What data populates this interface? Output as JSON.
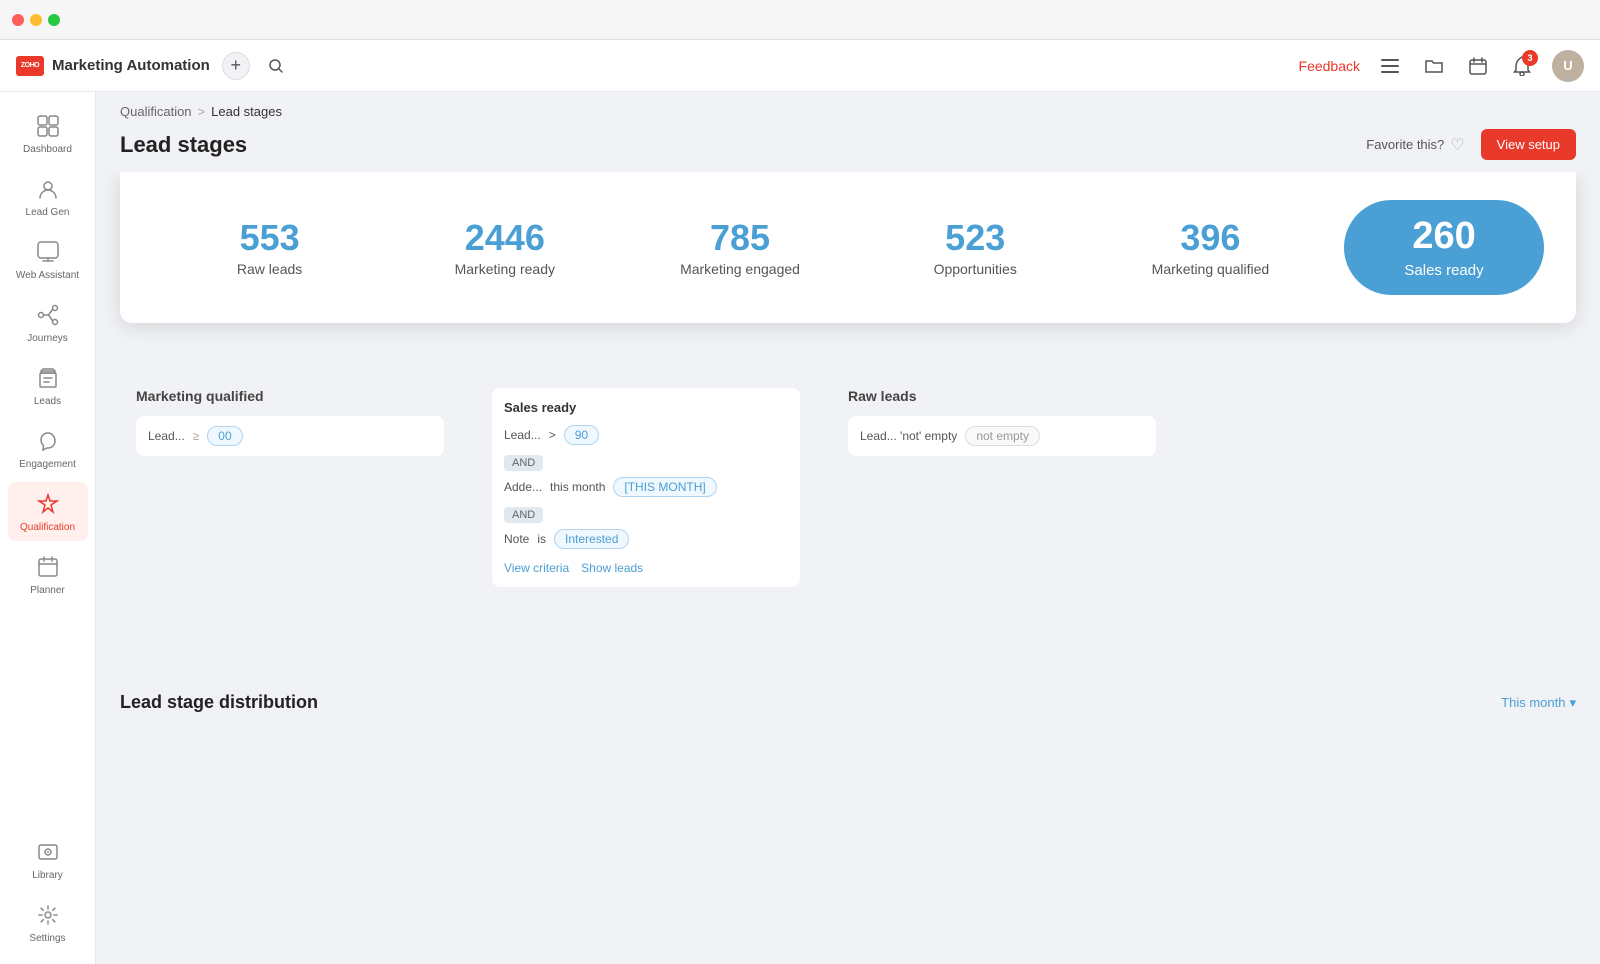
{
  "titlebar": {
    "dots": [
      "red",
      "yellow",
      "green"
    ]
  },
  "topnav": {
    "logo_text": "Marketing Automation",
    "zoho_text": "ZOHO",
    "plus_label": "+",
    "feedback_label": "Feedback",
    "notification_count": "3",
    "view_setup_label": "View setup",
    "favorite_text": "Favorite this?"
  },
  "breadcrumb": {
    "parent": "Qualification",
    "separator": ">",
    "current": "Lead stages"
  },
  "page": {
    "title": "Lead stages"
  },
  "stats": {
    "items": [
      {
        "number": "553",
        "label": "Raw leads"
      },
      {
        "number": "2446",
        "label": "Marketing ready"
      },
      {
        "number": "785",
        "label": "Marketing engaged"
      },
      {
        "number": "523",
        "label": "Opportunities"
      },
      {
        "number": "396",
        "label": "Marketing qualified"
      }
    ],
    "sales_ready": {
      "number": "260",
      "label": "Sales ready"
    }
  },
  "sidebar": {
    "items": [
      {
        "id": "dashboard",
        "label": "Dashboard",
        "icon": "⊞"
      },
      {
        "id": "lead-gen",
        "label": "Lead Gen",
        "icon": "👤"
      },
      {
        "id": "web-assistant",
        "label": "Web Assistant",
        "icon": "💬"
      },
      {
        "id": "journeys",
        "label": "Journeys",
        "icon": "🗺"
      },
      {
        "id": "leads",
        "label": "Leads",
        "icon": "🏷"
      },
      {
        "id": "engagement",
        "label": "Engagement",
        "icon": "📣"
      },
      {
        "id": "qualification",
        "label": "Qualification",
        "icon": "⚡",
        "active": true
      },
      {
        "id": "planner",
        "label": "Planner",
        "icon": "📅"
      },
      {
        "id": "library",
        "label": "Library",
        "icon": "🖼"
      },
      {
        "id": "settings",
        "label": "Settings",
        "icon": "⚙"
      }
    ]
  },
  "cards": {
    "marketing_qualified": {
      "title": "Marketing qualified",
      "condition_field": "Lead...",
      "condition_value": "00"
    },
    "sales_ready": {
      "title": "Sales ready",
      "criteria": [
        {
          "field": "Lead...",
          "op": ">",
          "value": "90",
          "and": false
        },
        {
          "field": "Adde...",
          "op": "this month",
          "value": "[THIS MONTH]",
          "and": true
        },
        {
          "field": "Note",
          "op": "is",
          "value": "Interested",
          "and": true
        }
      ],
      "links": [
        {
          "label": "View criteria"
        },
        {
          "label": "Show leads"
        }
      ]
    },
    "raw_leads": {
      "title": "Raw leads",
      "condition_field": "Lead... 'not' empty"
    }
  },
  "distribution": {
    "title": "Lead stage distribution",
    "filter_label": "This month",
    "filter_icon": "▾"
  }
}
